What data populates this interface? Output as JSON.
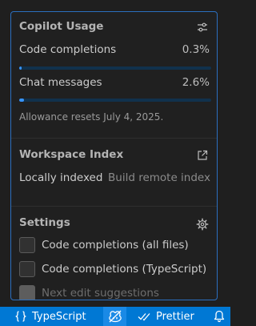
{
  "copilot_usage": {
    "title": "Copilot Usage",
    "settings_icon": "settings-sliders-icon",
    "code_completions": {
      "label": "Code completions",
      "percent_text": "0.3%",
      "fraction": 0.003
    },
    "chat_messages": {
      "label": "Chat messages",
      "percent_text": "2.6%",
      "fraction": 0.026
    },
    "reset_note": "Allowance resets July 4, 2025."
  },
  "workspace_index": {
    "title": "Workspace Index",
    "open_icon": "open-external-icon",
    "status": "Locally indexed",
    "action": "Build remote index"
  },
  "settings": {
    "title": "Settings",
    "gear_icon": "gear-icon",
    "options": [
      {
        "label": "Code completions (all files)",
        "checked": false,
        "disabled": false
      },
      {
        "label": "Code completions (TypeScript)",
        "checked": false,
        "disabled": false
      },
      {
        "label": "Next edit suggestions",
        "checked": false,
        "disabled": true
      }
    ]
  },
  "statusbar": {
    "language": "TypeScript",
    "language_icon": "braces-icon",
    "copilot_icon": "copilot-icon",
    "formatter": "Prettier",
    "formatter_icon": "double-check-icon",
    "notifications_icon": "bell-icon"
  },
  "colors": {
    "accent": "#3794ff",
    "statusbar": "#0078d4",
    "panel_border": "#2b6fbf",
    "panel_bg": "#202020"
  }
}
